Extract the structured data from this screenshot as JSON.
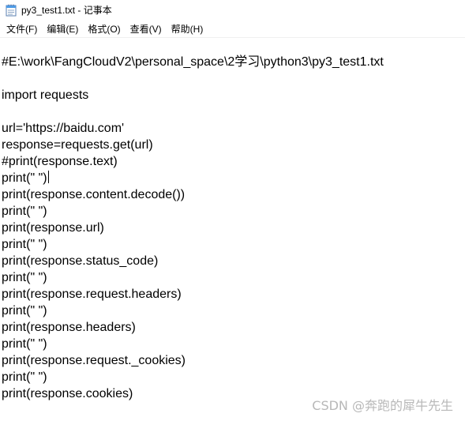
{
  "window": {
    "title": "py3_test1.txt - 记事本",
    "icon": "notepad-icon"
  },
  "menu": [
    {
      "label": "文件(F)"
    },
    {
      "label": "编辑(E)"
    },
    {
      "label": "格式(O)"
    },
    {
      "label": "查看(V)"
    },
    {
      "label": "帮助(H)"
    }
  ],
  "editor": {
    "lines": [
      "#E:\\work\\FangCloudV2\\personal_space\\2学习\\python3\\py3_test1.txt",
      "",
      "import requests",
      "",
      "url='https://baidu.com'",
      "response=requests.get(url)",
      "#print(response.text)",
      "print(\" \")",
      "print(response.content.decode())",
      "print(\" \")",
      "print(response.url)",
      "print(\" \")",
      "print(response.status_code)",
      "print(\" \")",
      "print(response.request.headers)",
      "print(\" \")",
      "print(response.headers)",
      "print(\" \")",
      "print(response.request._cookies)",
      "print(\" \")",
      "print(response.cookies)"
    ],
    "caret_line": 7
  },
  "watermark": {
    "text": "CSDN @奔跑的犀牛先生"
  }
}
